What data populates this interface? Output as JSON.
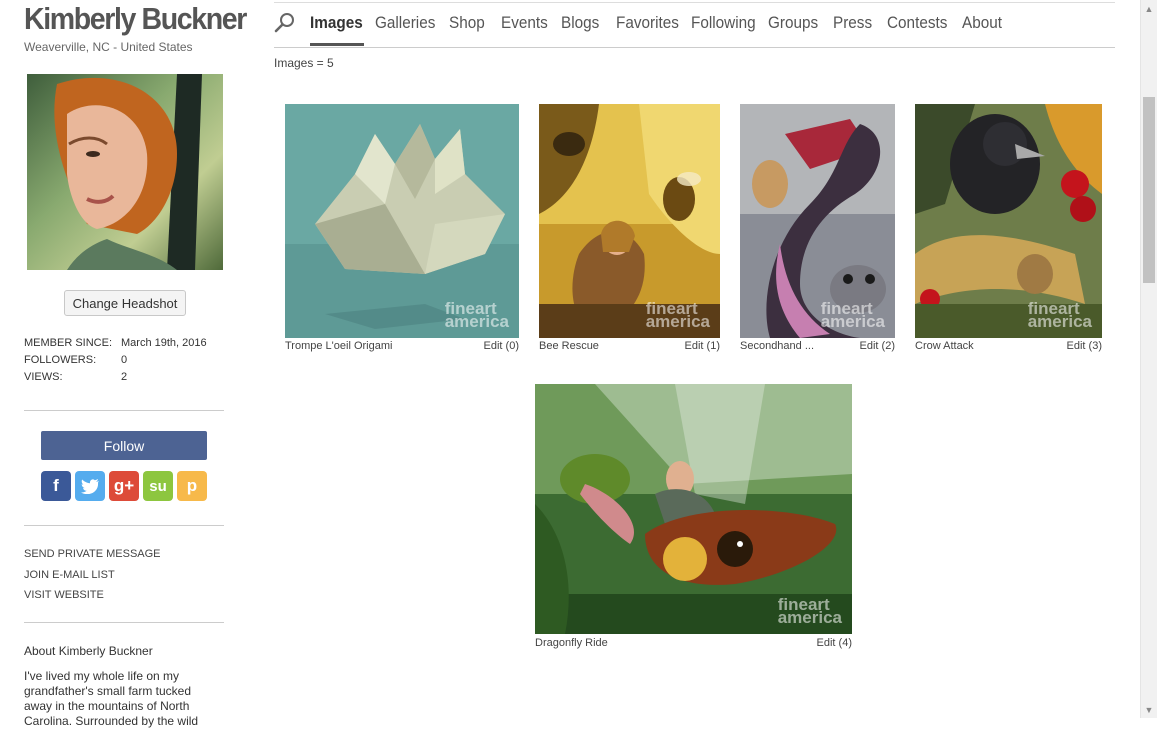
{
  "artist": {
    "name": "Kimberly Buckner",
    "location": "Weaverville, NC - United States",
    "change_headshot_label": "Change Headshot"
  },
  "stats": {
    "member_since_label": "MEMBER SINCE:",
    "member_since_value": "March 19th, 2016",
    "followers_label": "FOLLOWERS:",
    "followers_value": "0",
    "views_label": "VIEWS:",
    "views_value": "2"
  },
  "follow_label": "Follow",
  "social": {
    "facebook": {
      "glyph": "f",
      "color": "#3b5998",
      "icon": "facebook-icon"
    },
    "twitter": {
      "glyph": "t",
      "color": "#55acee",
      "icon": "twitter-icon"
    },
    "googleplus": {
      "glyph": "g+",
      "color": "#dd4b39",
      "icon": "google-plus-icon"
    },
    "stumbleupon": {
      "glyph": "su",
      "color": "#8dc63f",
      "icon": "stumbleupon-icon"
    },
    "pinterest": {
      "glyph": "p",
      "color": "#f7b94a",
      "icon": "pinterest-icon"
    }
  },
  "links": {
    "private_message": "SEND PRIVATE MESSAGE",
    "email_list": "JOIN E-MAIL LIST",
    "website": "VISIT WEBSITE"
  },
  "about": {
    "title": "About Kimberly Buckner",
    "text": "I've lived my whole life on my grandfather's small farm tucked away in the mountains of North Carolina. Surrounded by the wild"
  },
  "nav": {
    "items": [
      "Images",
      "Galleries",
      "Shop",
      "Events",
      "Blogs",
      "Favorites",
      "Following",
      "Groups",
      "Press",
      "Contests",
      "About"
    ],
    "active": "Images"
  },
  "image_count": "Images = 5",
  "watermark": {
    "line1": "fineart",
    "line2": "america"
  },
  "images": [
    {
      "title": "Trompe L'oeil Origami",
      "edit": "Edit (0)"
    },
    {
      "title": "Bee Rescue",
      "edit": "Edit (1)"
    },
    {
      "title": "Secondhand ...",
      "edit": "Edit (2)"
    },
    {
      "title": "Crow Attack",
      "edit": "Edit (3)"
    },
    {
      "title": "Dragonfly Ride",
      "edit": "Edit (4)"
    }
  ],
  "colors": {
    "follow_button": "#4d6393",
    "scrollbar_thumb": "#c1c1c1"
  }
}
